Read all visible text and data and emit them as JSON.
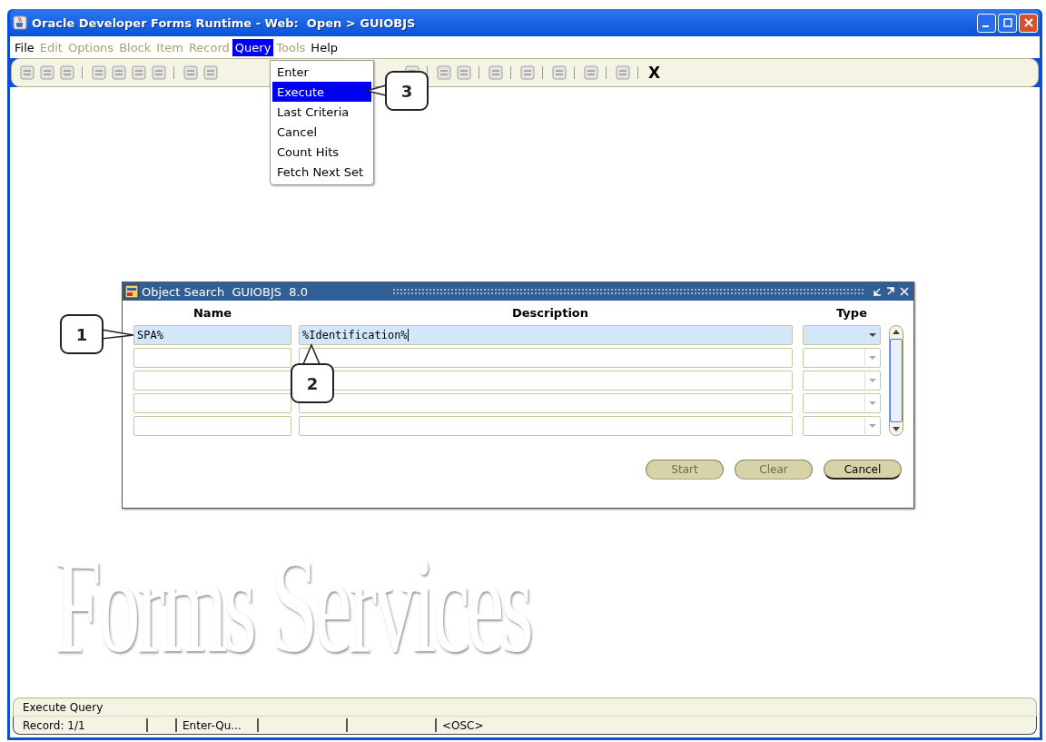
{
  "window": {
    "title": "Oracle Developer Forms Runtime - Web:  Open > GUIOBJS"
  },
  "menu": [
    {
      "label": "File",
      "disabled": false,
      "selected": false
    },
    {
      "label": "Edit",
      "disabled": true,
      "selected": false
    },
    {
      "label": "Options",
      "disabled": true,
      "selected": false
    },
    {
      "label": "Block",
      "disabled": true,
      "selected": false
    },
    {
      "label": "Item",
      "disabled": true,
      "selected": false
    },
    {
      "label": "Record",
      "disabled": true,
      "selected": false
    },
    {
      "label": "Query",
      "disabled": false,
      "selected": true
    },
    {
      "label": "Tools",
      "disabled": true,
      "selected": false
    },
    {
      "label": "Help",
      "disabled": false,
      "selected": false
    }
  ],
  "query_menu": [
    {
      "label": "Enter",
      "selected": false
    },
    {
      "label": "Execute",
      "selected": true
    },
    {
      "label": "Last Criteria",
      "selected": false
    },
    {
      "label": "Cancel",
      "selected": false
    },
    {
      "label": "Count Hits",
      "selected": false
    },
    {
      "label": "Fetch Next Set",
      "selected": false
    }
  ],
  "toolbar": {
    "exit_label": "X"
  },
  "background_logo": "Forms Services",
  "dialog": {
    "title": "Object Search  GUIOBJS  8.0",
    "columns": [
      "Name",
      "Description",
      "Type"
    ],
    "rows": [
      {
        "name": "SPA%",
        "description": "%Identification%",
        "selected": true
      },
      {
        "selected": false
      },
      {
        "selected": false
      },
      {
        "selected": false
      },
      {
        "selected": false
      }
    ],
    "buttons": [
      {
        "label": "Start",
        "disabled": true
      },
      {
        "label": "Clear",
        "disabled": true
      },
      {
        "label": "Cancel",
        "disabled": false
      }
    ]
  },
  "callouts": [
    {
      "label": "1",
      "kind": "right"
    },
    {
      "label": "2",
      "kind": "up"
    },
    {
      "label": "3",
      "kind": "left"
    }
  ],
  "status_bar": {
    "message": "Execute Query",
    "fields": [
      "Record: 1/1",
      "Enter-Qu...",
      "<OSC>"
    ]
  }
}
